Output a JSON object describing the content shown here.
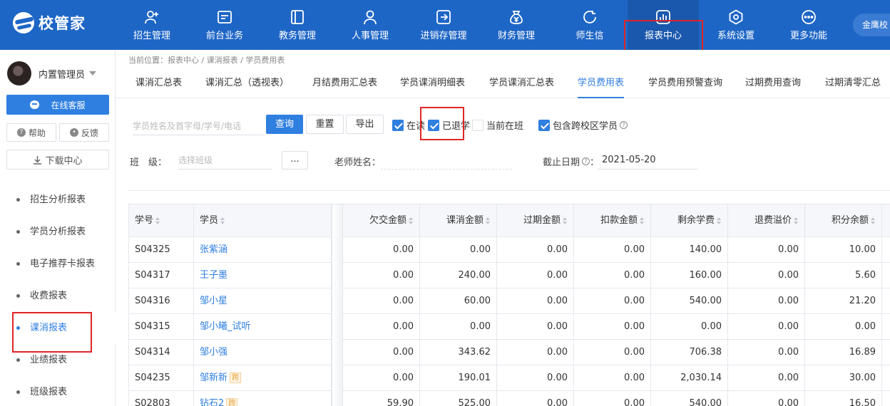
{
  "app": {
    "logo_text": "校管家",
    "campus": "金鹰校"
  },
  "topnav": [
    {
      "label": "招生管理",
      "icon": "person-add-icon"
    },
    {
      "label": "前台业务",
      "icon": "desk-icon"
    },
    {
      "label": "教务管理",
      "icon": "book-icon"
    },
    {
      "label": "人事管理",
      "icon": "person-icon"
    },
    {
      "label": "进销存管理",
      "icon": "inventory-icon"
    },
    {
      "label": "财务管理",
      "icon": "money-bag-icon"
    },
    {
      "label": "师生信",
      "icon": "chat-icon"
    },
    {
      "label": "报表中心",
      "icon": "report-icon"
    },
    {
      "label": "系统设置",
      "icon": "settings-icon"
    },
    {
      "label": "更多功能",
      "icon": "more-icon"
    }
  ],
  "sidebar": {
    "user_name": "内置管理员",
    "online_service": "在线客服",
    "help": "帮助",
    "feedback": "反馈",
    "download": "下载中心",
    "items": [
      {
        "label": "招生分析报表"
      },
      {
        "label": "学员分析报表"
      },
      {
        "label": "电子推荐卡报表"
      },
      {
        "label": "收费报表"
      },
      {
        "label": "课消报表"
      },
      {
        "label": "业绩报表"
      },
      {
        "label": "班级报表"
      }
    ]
  },
  "breadcrumb": "当前位置：报表中心 / 课消报表 / 学员费用表",
  "tabs": [
    {
      "label": "课消汇总表"
    },
    {
      "label": "课消汇总（透视表）"
    },
    {
      "label": "月结费用汇总表"
    },
    {
      "label": "学员课消明细表"
    },
    {
      "label": "学员课消汇总表"
    },
    {
      "label": "学员费用表"
    },
    {
      "label": "学员费用预警查询"
    },
    {
      "label": "过期费用查询"
    },
    {
      "label": "过期清零汇总"
    }
  ],
  "filters": {
    "search_placeholder": "学员姓名及首字母/学号/电话",
    "query": "查询",
    "reset": "重置",
    "export": "导出",
    "chk_enrolled": "在读",
    "chk_withdrawn": "已退学",
    "chk_current_class": "当前在班",
    "chk_cross_campus": "包含跨校区学员",
    "class_label": "班　级：",
    "class_placeholder": "选择班级",
    "more_btn": "...",
    "teacher_label": "老师姓名：",
    "date_label": "截止日期",
    "date_suffix": "：",
    "date_value": "2021-05-20"
  },
  "table": {
    "headers": [
      "学号",
      "学员",
      "欠交金额",
      "课消金额",
      "过期金额",
      "扣款金额",
      "剩余学费",
      "退费溢价",
      "积分余额"
    ],
    "rows": [
      {
        "id": "S04325",
        "name": "张紫涵",
        "tag": "",
        "cells": [
          "0.00",
          "0.00",
          "0.00",
          "0.00",
          "140.00",
          "0.00",
          "10.00"
        ]
      },
      {
        "id": "S04317",
        "name": "王子墨",
        "tag": "",
        "cells": [
          "0.00",
          "240.00",
          "0.00",
          "0.00",
          "160.00",
          "0.00",
          "5.60"
        ]
      },
      {
        "id": "S04316",
        "name": "邹小星",
        "tag": "",
        "cells": [
          "0.00",
          "60.00",
          "0.00",
          "0.00",
          "540.00",
          "0.00",
          "21.20"
        ]
      },
      {
        "id": "S04315",
        "name": "邹小曦_试听",
        "tag": "",
        "cells": [
          "0.00",
          "0.00",
          "0.00",
          "0.00",
          "0.00",
          "0.00",
          "0.00"
        ]
      },
      {
        "id": "S04314",
        "name": "邹小强",
        "tag": "",
        "cells": [
          "0.00",
          "343.62",
          "0.00",
          "0.00",
          "706.38",
          "0.00",
          "16.89"
        ]
      },
      {
        "id": "S04235",
        "name": "邹新新",
        "tag": "跨",
        "cells": [
          "0.00",
          "190.01",
          "0.00",
          "0.00",
          "2,030.14",
          "0.00",
          "30.00"
        ]
      },
      {
        "id": "S02803",
        "name": "钻石2",
        "tag": "跨",
        "cells": [
          "59.90",
          "525.00",
          "0.00",
          "0.00",
          "540.00",
          "0.00",
          "16.50"
        ]
      }
    ]
  }
}
